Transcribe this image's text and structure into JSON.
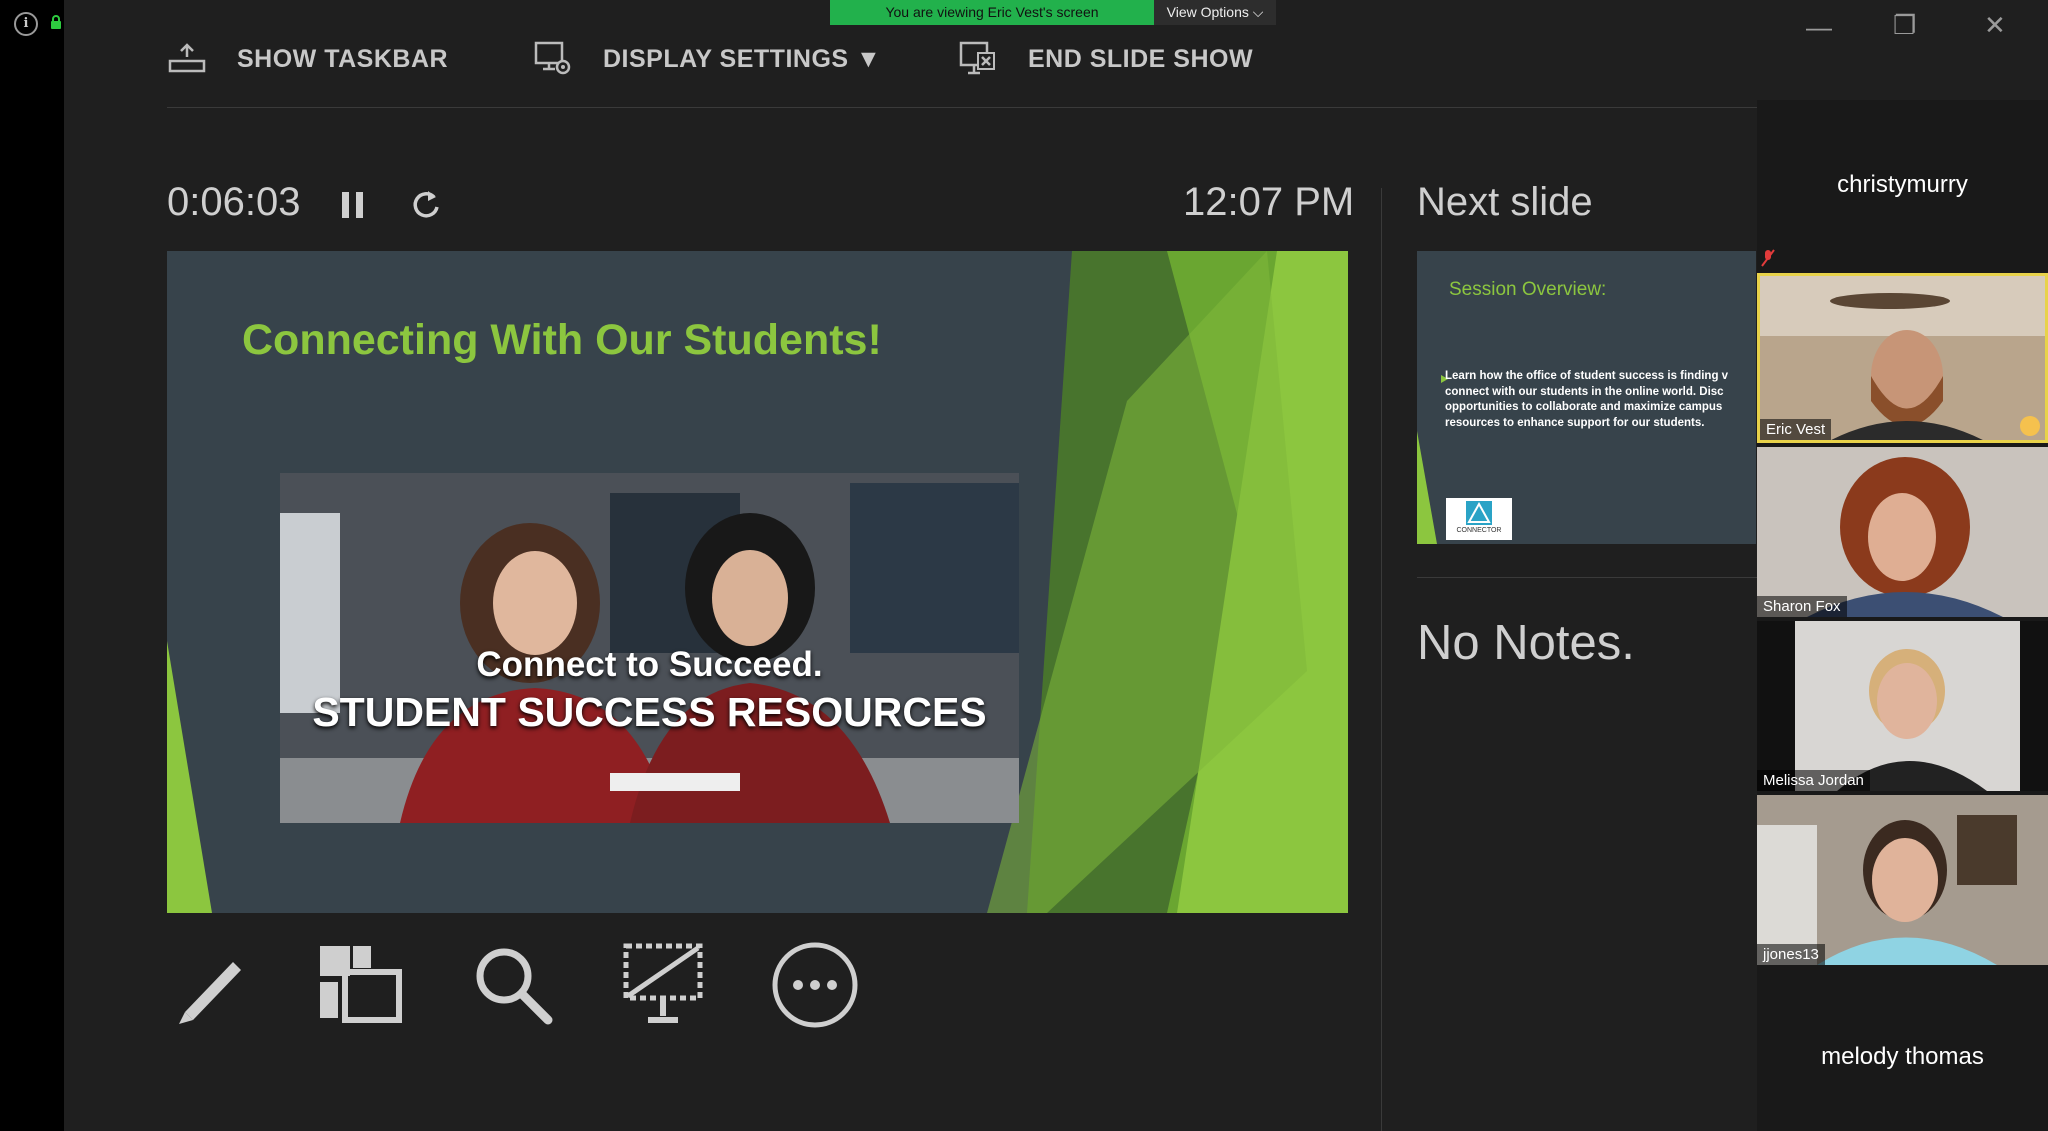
{
  "banner": {
    "viewing_text": "You are viewing Eric Vest's screen",
    "view_options_label": "View Options ⌵"
  },
  "window_controls": {
    "minimize": "—",
    "restore": "❐",
    "close": "✕"
  },
  "toolbar": {
    "show_taskbar": "SHOW TASKBAR",
    "display_settings": "DISPLAY SETTINGS ▼",
    "end_slide_show": "END SLIDE SHOW"
  },
  "presenter": {
    "elapsed_time": "0:06:03",
    "clock": "12:07 PM",
    "next_slide_label": "Next slide",
    "notes_text": "No Notes."
  },
  "current_slide": {
    "title": "Connecting With Our Students!",
    "caption_line1": "Connect to Succeed.",
    "caption_line2": "STUDENT SUCCESS RESOURCES"
  },
  "next_slide": {
    "title": "Session Overview:",
    "body": "Learn how the office of student success is finding v connect with our students in the online world. Disc opportunities to collaborate and maximize campus resources to enhance support for our students.",
    "logo_text": "CONNECTOR"
  },
  "tools": [
    "pen-icon",
    "slides-grid-icon",
    "zoom-icon",
    "black-screen-icon",
    "more-icon"
  ],
  "participants": {
    "top_name": "christymurry",
    "tiles": [
      {
        "name": "Eric Vest"
      },
      {
        "name": "Sharon Fox"
      },
      {
        "name": "Melissa Jordan"
      },
      {
        "name": "jjones13"
      }
    ],
    "bottom_name": "melody thomas"
  },
  "colors": {
    "accent_green": "#8cc63f",
    "banner_green": "#22b14c",
    "active_speaker": "#e8d24a"
  }
}
